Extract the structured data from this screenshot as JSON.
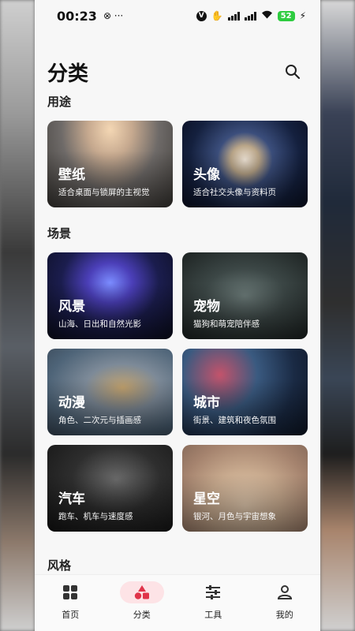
{
  "status_bar": {
    "time": "00:23",
    "extra": "⊗ ···",
    "battery": "52"
  },
  "header": {
    "title": "分类"
  },
  "sections": {
    "usage": {
      "title": "用途",
      "cards": [
        {
          "title": "壁纸",
          "subtitle": "适合桌面与锁屏的主视觉"
        },
        {
          "title": "头像",
          "subtitle": "适合社交头像与资料页"
        }
      ]
    },
    "scene": {
      "title": "场景",
      "cards": [
        {
          "title": "风景",
          "subtitle": "山海、日出和自然光影"
        },
        {
          "title": "宠物",
          "subtitle": "猫狗和萌宠陪伴感"
        },
        {
          "title": "动漫",
          "subtitle": "角色、二次元与插画感"
        },
        {
          "title": "城市",
          "subtitle": "街景、建筑和夜色氛围"
        },
        {
          "title": "汽车",
          "subtitle": "跑车、机车与速度感"
        },
        {
          "title": "星空",
          "subtitle": "银河、月色与宇宙想象"
        }
      ]
    },
    "style": {
      "title": "风格"
    }
  },
  "nav": {
    "items": [
      {
        "label": "首页",
        "icon": "grid-icon"
      },
      {
        "label": "分类",
        "icon": "shapes-icon"
      },
      {
        "label": "工具",
        "icon": "sliders-icon"
      },
      {
        "label": "我的",
        "icon": "person-icon"
      }
    ],
    "active_color": "#e0344a",
    "active_bg": "#fde3e6"
  }
}
